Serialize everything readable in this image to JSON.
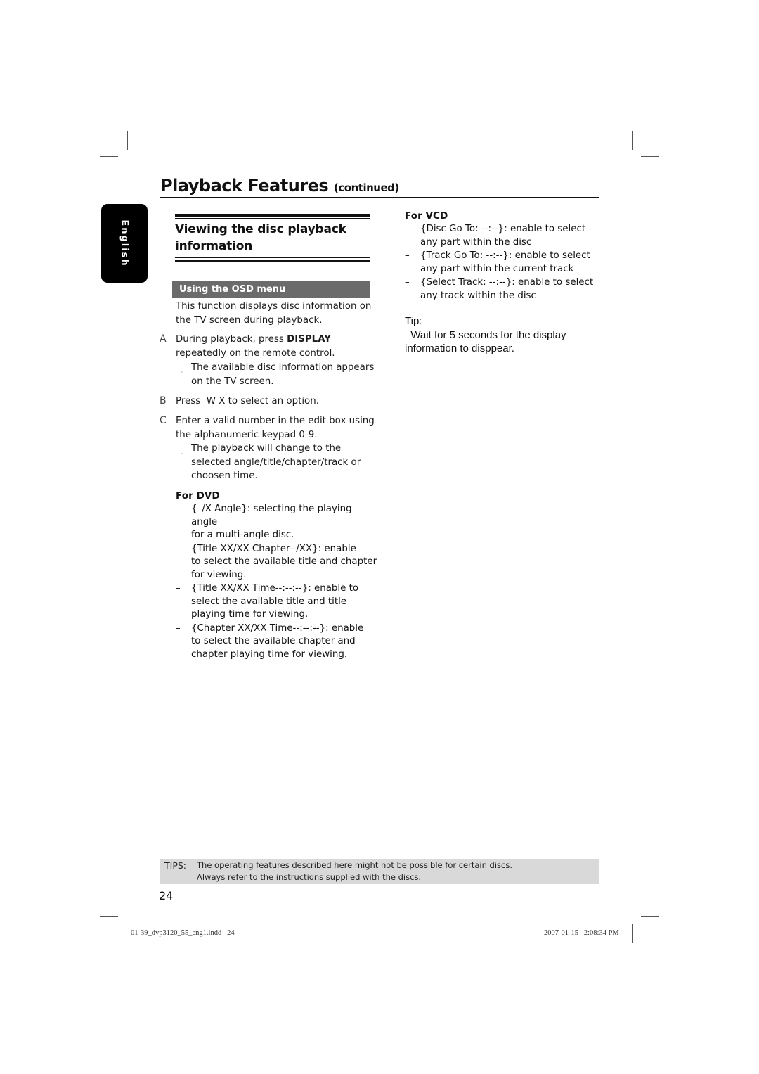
{
  "header": {
    "title": "Playback Features",
    "title_suffix": "(continued)",
    "language_tab": "English"
  },
  "section": {
    "title_line1": "Viewing the disc playback",
    "title_line2": "information",
    "subheading": "Using the OSD menu",
    "intro": [
      "This function displays disc information on",
      "the TV screen during playback."
    ],
    "steps": [
      {
        "letter": "A",
        "lines_pre": "During playback, press ",
        "bold": "DISPLAY",
        "line2": "repeatedly on the remote control.",
        "result_marker": "¸",
        "result": [
          "The available disc information appears",
          "on the TV screen."
        ]
      },
      {
        "letter": "B",
        "text": "Press  W X to select an option."
      },
      {
        "letter": "C",
        "lines": [
          "Enter a valid number in the edit box using",
          "the alphanumeric keypad 0-9."
        ],
        "result_marker": "¸",
        "result": [
          "The playback will change to the",
          "selected angle/title/chapter/track or",
          "choosen time."
        ]
      }
    ]
  },
  "dvd": {
    "heading": "For DVD",
    "items": [
      [
        "{_/X Angle}: selecting the playing angle",
        "for a multi-angle disc."
      ],
      [
        "{Title XX/XX Chapter--/XX}: enable",
        "to select the available title and chapter",
        "for viewing."
      ],
      [
        "{Title XX/XX Time--:--:--}: enable to",
        "select the available title and title",
        "playing time for viewing."
      ],
      [
        "{Chapter XX/XX Time--:--:--}: enable",
        "to select the available chapter and",
        "chapter playing time for viewing."
      ]
    ]
  },
  "vcd": {
    "heading": "For VCD",
    "items": [
      [
        "{Disc Go To: --:--}: enable to select",
        "any part within the disc"
      ],
      [
        "{Track Go To: --:--}: enable to select",
        "any part within the current track"
      ],
      [
        "{Select Track: --:--}: enable to select",
        "any track within the disc"
      ]
    ]
  },
  "tip": {
    "label": "Tip:",
    "lines": [
      "  Wait for 5 seconds for the display",
      "information to disppear."
    ]
  },
  "tips_box": {
    "label": "TIPS:",
    "lines": [
      "The operating features described here might not be possible for certain discs.",
      "Always refer to the instructions supplied with the discs."
    ]
  },
  "page_number": "24",
  "footer": {
    "file": "01-39_dvp3120_55_eng1.indd   24",
    "timestamp": "2007-01-15   2:08:34 PM"
  },
  "dash": "–"
}
